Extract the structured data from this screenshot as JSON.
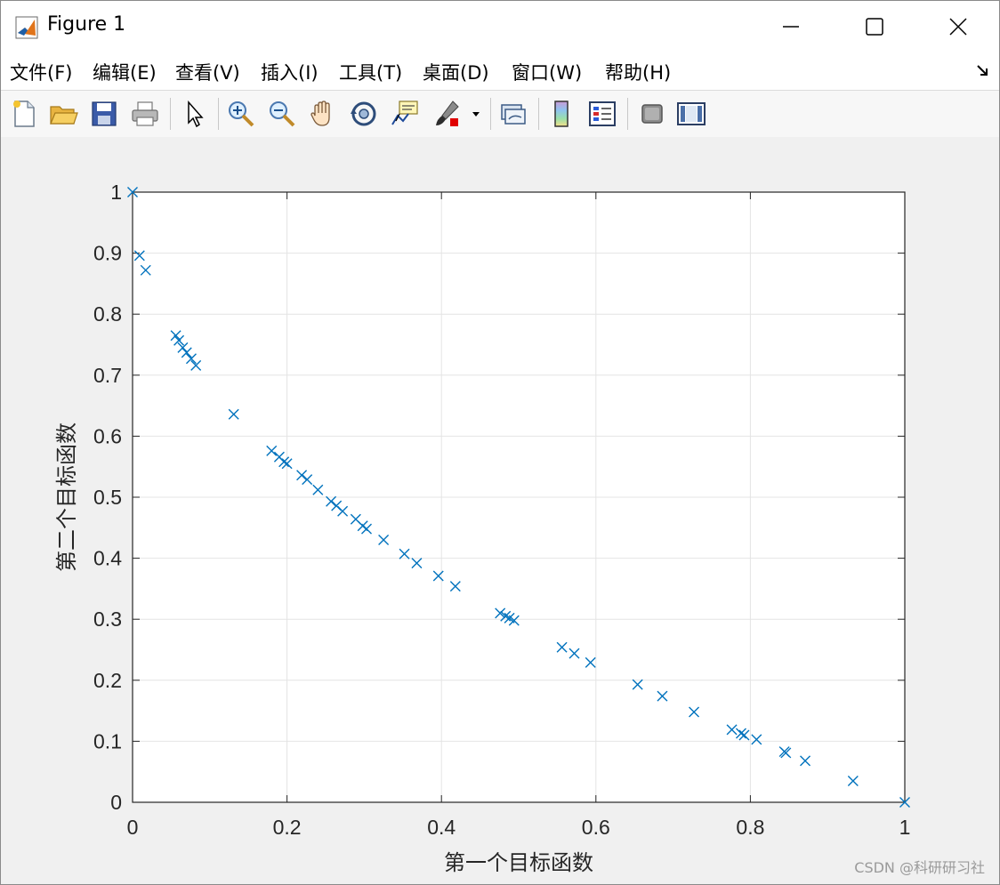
{
  "window": {
    "title": "Figure 1",
    "controls": {
      "minimize": "minimize",
      "maximize": "maximize",
      "close": "close"
    }
  },
  "menu": [
    {
      "label": "文件(F)"
    },
    {
      "label": "编辑(E)"
    },
    {
      "label": "查看(V)"
    },
    {
      "label": "插入(I)"
    },
    {
      "label": "工具(T)"
    },
    {
      "label": "桌面(D)"
    },
    {
      "label": "窗口(W)"
    },
    {
      "label": "帮助(H)"
    }
  ],
  "toolbar": {
    "icons": [
      "new-figure-icon",
      "open-folder-icon",
      "save-icon",
      "print-icon",
      "pointer-icon",
      "zoom-in-icon",
      "zoom-out-icon",
      "pan-hand-icon",
      "rotate-3d-icon",
      "data-cursor-icon",
      "brush-icon",
      "brush-dropdown-icon",
      "link-plot-icon",
      "colorbar-icon",
      "legend-icon",
      "hide-plot-tools-icon",
      "show-plot-tools-icon"
    ]
  },
  "chart_data": {
    "type": "scatter",
    "marker": "x",
    "color": "#0072bd",
    "xlabel": "第一个目标函数",
    "ylabel": "第二个目标函数",
    "xlim": [
      0,
      1
    ],
    "ylim": [
      0,
      1
    ],
    "grid": true,
    "xticks": [
      "0",
      "0.2",
      "0.4",
      "0.6",
      "0.8",
      "1"
    ],
    "yticks": [
      "0",
      "0.1",
      "0.2",
      "0.3",
      "0.4",
      "0.5",
      "0.6",
      "0.7",
      "0.8",
      "0.9",
      "1"
    ],
    "points": [
      [
        0.0,
        1.0
      ],
      [
        0.009,
        0.896
      ],
      [
        0.017,
        0.872
      ],
      [
        0.056,
        0.765
      ],
      [
        0.06,
        0.757
      ],
      [
        0.065,
        0.745
      ],
      [
        0.07,
        0.737
      ],
      [
        0.076,
        0.727
      ],
      [
        0.082,
        0.716
      ],
      [
        0.131,
        0.636
      ],
      [
        0.18,
        0.576
      ],
      [
        0.19,
        0.566
      ],
      [
        0.196,
        0.558
      ],
      [
        0.2,
        0.555
      ],
      [
        0.219,
        0.536
      ],
      [
        0.226,
        0.529
      ],
      [
        0.24,
        0.512
      ],
      [
        0.257,
        0.493
      ],
      [
        0.264,
        0.486
      ],
      [
        0.272,
        0.477
      ],
      [
        0.289,
        0.464
      ],
      [
        0.298,
        0.453
      ],
      [
        0.303,
        0.448
      ],
      [
        0.325,
        0.43
      ],
      [
        0.352,
        0.407
      ],
      [
        0.368,
        0.392
      ],
      [
        0.396,
        0.371
      ],
      [
        0.418,
        0.354
      ],
      [
        0.476,
        0.31
      ],
      [
        0.483,
        0.305
      ],
      [
        0.488,
        0.302
      ],
      [
        0.494,
        0.298
      ],
      [
        0.556,
        0.254
      ],
      [
        0.572,
        0.244
      ],
      [
        0.593,
        0.229
      ],
      [
        0.654,
        0.193
      ],
      [
        0.686,
        0.174
      ],
      [
        0.727,
        0.148
      ],
      [
        0.776,
        0.119
      ],
      [
        0.788,
        0.113
      ],
      [
        0.792,
        0.11
      ],
      [
        0.808,
        0.103
      ],
      [
        0.844,
        0.083
      ],
      [
        0.846,
        0.081
      ],
      [
        0.871,
        0.068
      ],
      [
        0.933,
        0.035
      ],
      [
        1.0,
        0.0
      ]
    ]
  },
  "watermark": "CSDN @科研研习社"
}
